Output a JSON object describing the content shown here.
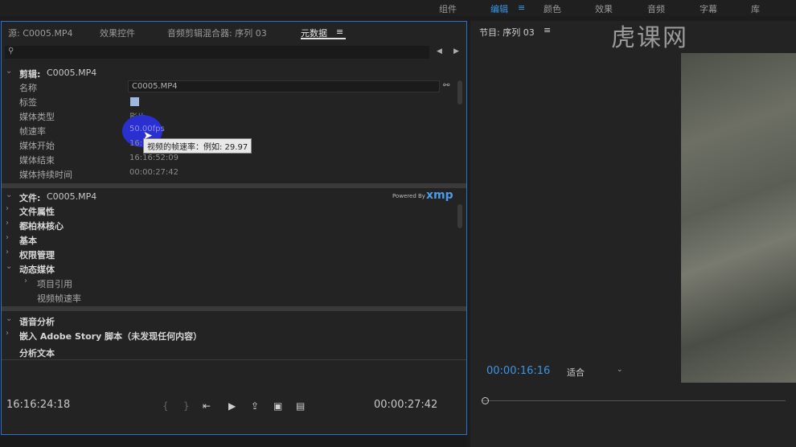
{
  "workspaces": [
    "组件",
    "编辑",
    "颜色",
    "效果",
    "音频",
    "字幕",
    "库"
  ],
  "active_workspace": "编辑",
  "watermark": "虎课网",
  "left_panel": {
    "tabs": [
      "源: C0005.MP4",
      "效果控件",
      "音频剪辑混合器: 序列 03",
      "元数据"
    ],
    "active_tab": "元数据",
    "clip_section": {
      "title": "剪辑:",
      "name": "C0005.MP4",
      "rows": [
        {
          "label": "名称",
          "value": "C0005.MP4"
        },
        {
          "label": "标签",
          "value": ""
        },
        {
          "label": "媒体类型",
          "value": "影片"
        },
        {
          "label": "帧速率",
          "value": "50.00fps"
        },
        {
          "label": "媒体开始",
          "value": "16:"
        },
        {
          "label": "媒体结束",
          "value": "16:16:52:09"
        },
        {
          "label": "媒体持续时间",
          "value": "00:00:27:42"
        }
      ]
    },
    "tooltip": "视频的帧速率：例如: 29.97",
    "file_section": {
      "title": "文件:",
      "name": "C0005.MP4",
      "powered_by": "Powered By",
      "xmp": "xmp",
      "items": [
        "文件属性",
        "都柏林核心",
        "基本",
        "权限管理",
        "动态媒体"
      ],
      "subitems": [
        "项目引用",
        "视频帧速率"
      ]
    },
    "speech": {
      "title": "语音分析",
      "embed": "嵌入 Adobe Story 脚本（未发现任何内容）",
      "analyze": "分析文本"
    },
    "timecode_in": "16:16:24:18",
    "timecode_dur": "00:00:27:42"
  },
  "program_panel": {
    "title": "节目: 序列 03",
    "timecode": "00:00:16:16",
    "fit": "适合"
  },
  "colors": {
    "accent": "#3a96e6",
    "panel_border": "#2d6fd1"
  }
}
